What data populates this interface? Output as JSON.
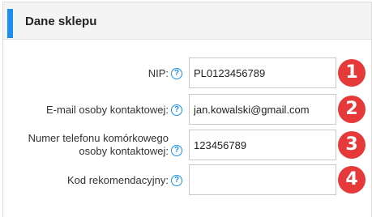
{
  "panel": {
    "title": "Dane sklepu"
  },
  "help_glyph": "?",
  "fields": [
    {
      "label_lines": [
        "NIP:"
      ],
      "value": "PL0123456789",
      "placeholder": "",
      "badge": "1"
    },
    {
      "label_lines": [
        "E-mail osoby kontaktowej:"
      ],
      "value": "jan.kowalski@gmail.com",
      "placeholder": "",
      "badge": "2"
    },
    {
      "label_lines": [
        "Numer telefonu komórkowego",
        "osoby kontaktowej:"
      ],
      "value": "123456789",
      "placeholder": "",
      "badge": "3"
    },
    {
      "label_lines": [
        "Kod rekomendacyjny:"
      ],
      "value": "",
      "placeholder": "",
      "badge": "4"
    }
  ],
  "colors": {
    "accent": "#1a8ff0",
    "badge": "#e63a3a"
  }
}
